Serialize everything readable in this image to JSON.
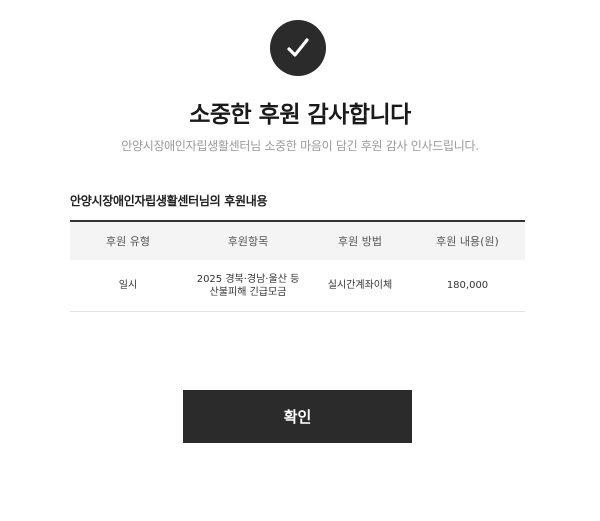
{
  "icon": {
    "name": "check-icon",
    "background": "#2b2b2b",
    "color": "#ffffff"
  },
  "title": "소중한 후원 감사합니다",
  "subtitle": "안양시장애인자립생활센터님 소중한 마음이 담긴 후원 감사 인사드립니다.",
  "section_title": "안양시장애인자립생활센터님의 후원내용",
  "table": {
    "headers": [
      "후원 유형",
      "후원항목",
      "후원 방법",
      "후원 내용(원)"
    ],
    "rows": [
      {
        "type": "일시",
        "item_line1": "2025 경북·경남·울산 등",
        "item_line2": "산불피해 긴급모금",
        "method": "실시간계좌이체",
        "amount": "180,000"
      }
    ]
  },
  "confirm_button": {
    "label": "확인"
  },
  "colors": {
    "dark": "#2b2b2b",
    "subtitle": "#9a9a9a",
    "header_bg": "#f4f4f4"
  }
}
